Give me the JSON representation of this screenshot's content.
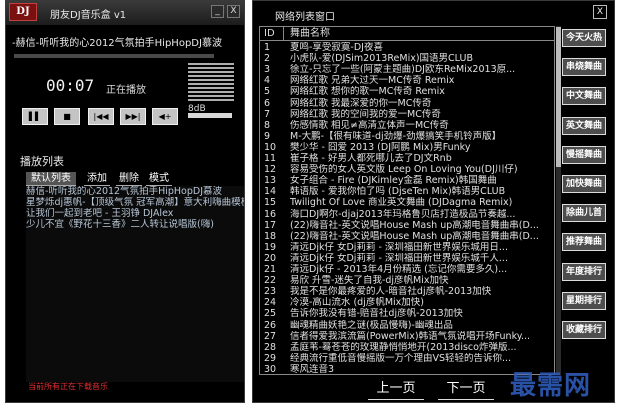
{
  "player": {
    "logo": "DJ",
    "title": "朋友DJ音乐盒 v1",
    "win_min": "_",
    "win_close": "X",
    "now_playing": "-赫信-听听我的心2012气氛拍手HipHopDJ慕波",
    "time": "00:07",
    "status": "正在播放",
    "volume_label": "8dB",
    "controls": [
      "▌▌",
      "■",
      "|◀◀",
      "▶▶|",
      "◀+"
    ],
    "playlist_title": "播放列表",
    "tabs": [
      "默认列表",
      "添加",
      "删除",
      "模式"
    ],
    "playlist": [
      "赫信-听听我的心2012气氛拍手HipHopDJ慕波",
      "星梦烁dj惠帆-【顶级气氛 冠军高潮】意大利嗨曲模板",
      "让我们一起到老吧 - 王羽铮 DJAlex",
      "少儿不宜《野花十三香》二人转让说唱版(嗨)"
    ],
    "footer": "当前所有正在下载音乐"
  },
  "list": {
    "title": "网络列表窗口",
    "close": "X",
    "col_id": "ID",
    "col_name": "舞曲名称",
    "rows": [
      {
        "id": "1",
        "name": "夏鸣-享受寂寞-DJ夜喜"
      },
      {
        "id": "2",
        "name": "小虎队-爱(DJSim2013ReMix)国语男CLUB"
      },
      {
        "id": "3",
        "name": "徐立-只忘了一些(阿蒙主题曲)DJ欧东ReMix2013原..."
      },
      {
        "id": "4",
        "name": "网络红歌 兄弟大过天一MC传奇 Remix"
      },
      {
        "id": "5",
        "name": "网络红歌 想你的歌一MC传奇 Remix"
      },
      {
        "id": "6",
        "name": "网络红歌 我最深爱的你一MC传奇"
      },
      {
        "id": "7",
        "name": "网络红歌 我的空间我的爱一MC传奇"
      },
      {
        "id": "8",
        "name": "伤感情歌 相见≠高清立体声一MC传奇"
      },
      {
        "id": "9",
        "name": "M-大鹏-【很有味道-dj劲爆-劲爆搞笑手机铃声版】"
      },
      {
        "id": "10",
        "name": "樊少华 - 囧爱 2013 (DJ阿鹏 Mix)男Funky"
      },
      {
        "id": "11",
        "name": "崔子格 - 好男人都死哪儿去了DJ文Rnb"
      },
      {
        "id": "12",
        "name": "容易受伤的女人英文版 Leep On Loving You(DJ川仔)"
      },
      {
        "id": "13",
        "name": "女子组合 - Fire (DJKimley金磊 Remix)韩国舞曲"
      },
      {
        "id": "14",
        "name": "韩语版 - 爱我你怕了吗 (DjseTen Mix)韩语男CLUB"
      },
      {
        "id": "15",
        "name": "Twilight Of Love 商业英文舞曲 (DJDagma Remix)"
      },
      {
        "id": "16",
        "name": "海口DJ啊尔-djaj2013年玛格鲁贝店打造极品节奏越..."
      },
      {
        "id": "17",
        "name": "(22)嗨音社-英文说唱House Mash up高潮电音舞曲串(D..."
      },
      {
        "id": "18",
        "name": "(22)嗨音社-英文说唱House Mash up高潮电音舞曲串(D..."
      },
      {
        "id": "19",
        "name": "清远Djk仔 女Dj莉莉 - 深圳福田新世界娱乐城用日..."
      },
      {
        "id": "20",
        "name": "清远Djk仔 女Dj莉莉 - 深圳福田新世界娱乐城千人..."
      },
      {
        "id": "21",
        "name": "清远Djk仔 - 2013年4月份精选 (忘记你需要多久)..."
      },
      {
        "id": "22",
        "name": "易欣 升雪-迷失了自我-dj彦帆Mix加快"
      },
      {
        "id": "23",
        "name": "我是不是你最疼爱的人-暗音社dj彦帆-2013加快"
      },
      {
        "id": "24",
        "name": "冷漠-高山流水 (dj彦帆Mix加快)"
      },
      {
        "id": "25",
        "name": "告诉你我没有错-赔音社dj彦帆-2013加快"
      },
      {
        "id": "26",
        "name": "幽魂精曲妖艳之谜(极品慢嗨)-幽魂出品"
      },
      {
        "id": "27",
        "name": "信者得爱我滨流篇(PowerMix)韩语气氛说唱开场Funky..."
      },
      {
        "id": "28",
        "name": "孟庭苇-蓦苍苍的玫瑰静悄悄地开(2013disco炸弹版..."
      },
      {
        "id": "29",
        "name": "经典流行重低音慢摇版一万个理由VS轻轻的告诉你..."
      },
      {
        "id": "30",
        "name": "寒风连音3"
      }
    ],
    "categories": [
      "今天火热",
      "串烧舞曲",
      "中文舞曲",
      "英文舞曲",
      "慢摇舞曲",
      "加快舞曲",
      "除曲儿首",
      "推荐舞曲",
      "年度排行",
      "星期排行",
      "收藏排行"
    ],
    "prev_page": "上一页",
    "next_page": "下一页"
  },
  "watermark": "最需网"
}
